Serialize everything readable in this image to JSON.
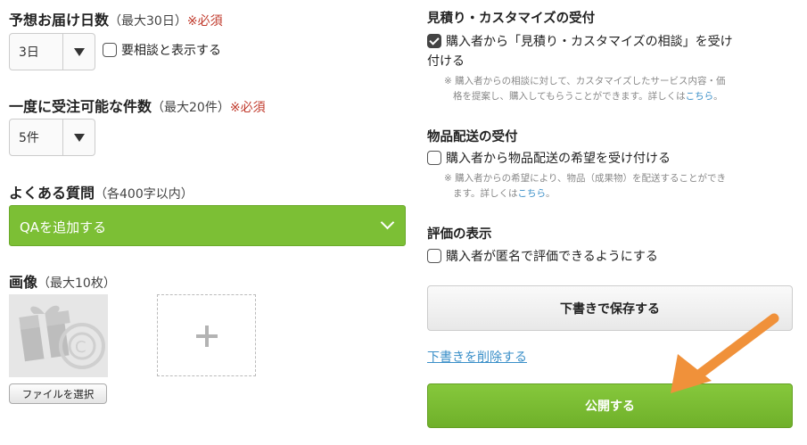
{
  "delivery_days": {
    "title": "予想お届け日数",
    "limit": "（最大30日）",
    "required": "※必須",
    "selected": "3日",
    "consult_label": "要相談と表示する",
    "consult_checked": false
  },
  "orders_capacity": {
    "title": "一度に受注可能な件数",
    "limit": "（最大20件）",
    "required": "※必須",
    "selected": "5件"
  },
  "faq": {
    "title": "よくある質問",
    "limit": "（各400字以内）",
    "add_label": "QAを追加する",
    "icon": "chevron-down-icon"
  },
  "images": {
    "title": "画像",
    "limit": "（最大10枚）",
    "file_button": "ファイルを選択",
    "add_icon": "plus-icon"
  },
  "estimate": {
    "title": "見積り・カスタマイズの受付",
    "checkbox_label_line1": "購入者から「見積り・カスタマイズの相談」を受け",
    "checkbox_label_line2": "付ける",
    "checked": true,
    "note_line1": "※ 購入者からの相談に対して、カスタマイズしたサービス内容・価",
    "note_line2": "格を提案し、購入してもらうことができます。詳しくは",
    "note_link": "こちら",
    "note_end": "。"
  },
  "shipping": {
    "title": "物品配送の受付",
    "checkbox_label": "購入者から物品配送の希望を受け付ける",
    "checked": false,
    "note_line1": "※ 購入者からの希望により、物品（成果物）を配送することができ",
    "note_line2": "ます。詳しくは",
    "note_link": "こちら",
    "note_end": "。"
  },
  "rating": {
    "title": "評価の表示",
    "checkbox_label": "購入者が匿名で評価できるようにする",
    "checked": false
  },
  "actions": {
    "save_draft": "下書きで保存する",
    "delete_draft": "下書きを削除する",
    "publish": "公開する"
  },
  "colors": {
    "accent_green": "#7cbf35",
    "required_red": "#c0392b",
    "link_blue": "#3a8fc8",
    "annotation_arrow": "#f0913a"
  }
}
